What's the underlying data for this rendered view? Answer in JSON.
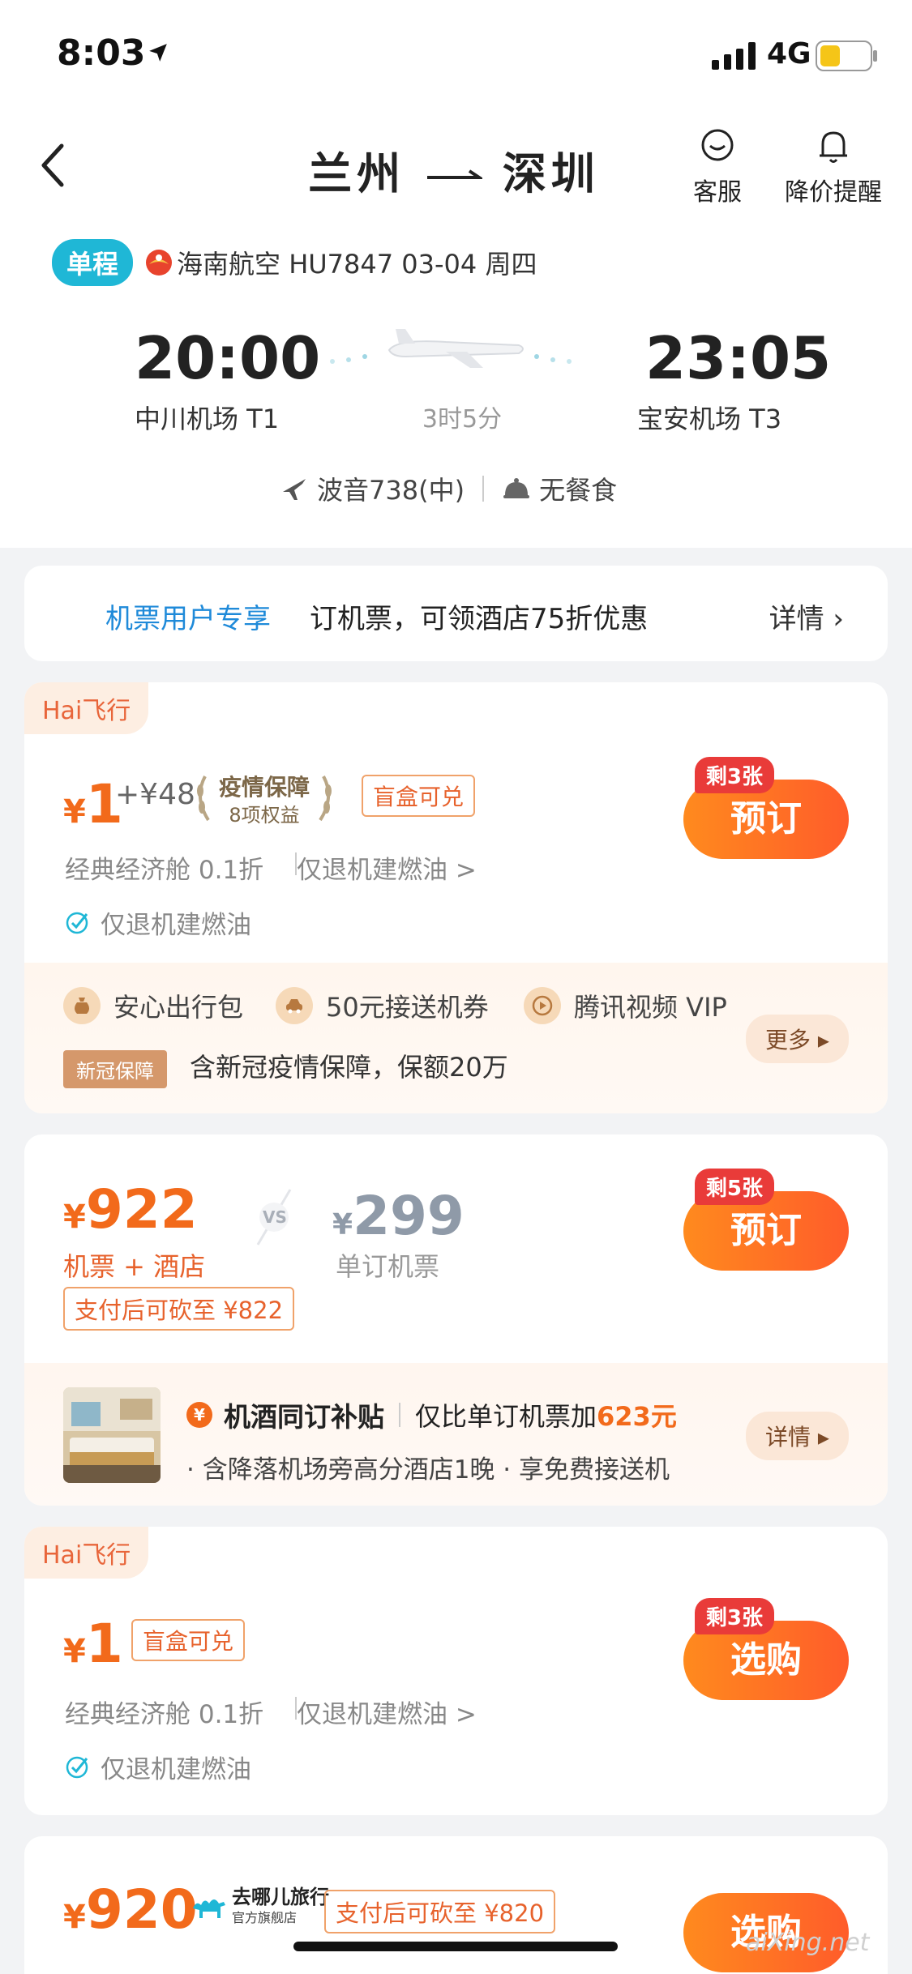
{
  "status_bar": {
    "time": "8:03",
    "network": "4G"
  },
  "nav": {
    "title_from": "兰州",
    "title_to": "深圳",
    "service_label": "客服",
    "alert_label": "降价提醒"
  },
  "flight": {
    "trip_type": "单程",
    "airline": "海南航空 HU7847  03-04 周四",
    "dep_time": "20:00",
    "dep_airport": "中川机场 T1",
    "arr_time": "23:05",
    "arr_airport": "宝安机场 T3",
    "duration": "3时5分",
    "aircraft": "波音738(中)",
    "meal": "无餐食"
  },
  "promo": {
    "tag": "机票用户专享",
    "text": "订机票，可领酒店75折优惠",
    "more": "详情 ›"
  },
  "card1": {
    "hai_tag": "Hai飞行",
    "yen": "¥",
    "price": "1",
    "extra": "+¥48",
    "laurel_title": "疫情保障",
    "laurel_sub": "8项权益",
    "blind_box": "盲盒可兑",
    "cabin": "经典经济舱 0.1折",
    "refund": "仅退机建燃油 >",
    "check": "仅退机建燃油",
    "remain": "剩3张",
    "button": "预订",
    "perks": [
      "安心出行包",
      "50元接送机券",
      "腾讯视频 VIP"
    ],
    "covid_tag": "新冠保障",
    "covid_text": "含新冠疫情保障，保额20万",
    "more": "更多 ▸"
  },
  "card2": {
    "yen": "¥",
    "price": "922",
    "price_label": "机票 + 酒店",
    "cut_tag": "支付后可砍至 ¥822",
    "vs": "VS",
    "compare_yen": "¥",
    "compare_price": "299",
    "compare_label": "单订机票",
    "remain": "剩5张",
    "button": "预订",
    "hotel_title": "机酒同订补贴",
    "hotel_extra_prefix": "仅比单订机票加",
    "hotel_extra_amount": "623元",
    "hotel_sub": "· 含降落机场旁高分酒店1晚 · 享免费接送机",
    "detail": "详情 ▸"
  },
  "card3": {
    "hai_tag": "Hai飞行",
    "yen": "¥",
    "price": "1",
    "blind_box": "盲盒可兑",
    "cabin": "经典经济舱 0.1折",
    "refund": "仅退机建燃油 >",
    "check": "仅退机建燃油",
    "remain": "剩3张",
    "button": "选购"
  },
  "card4": {
    "yen": "¥",
    "price": "920",
    "logo_name": "去哪儿旅行",
    "logo_sub": "官方旗舰店",
    "cut_tag": "支付后可砍至 ¥820",
    "button": "选购"
  },
  "watermark": "aiXing.net",
  "colors": {
    "accent_orange": "#f26a1b",
    "accent_blue": "#1f8ad9",
    "badge_red": "#e93b39"
  }
}
